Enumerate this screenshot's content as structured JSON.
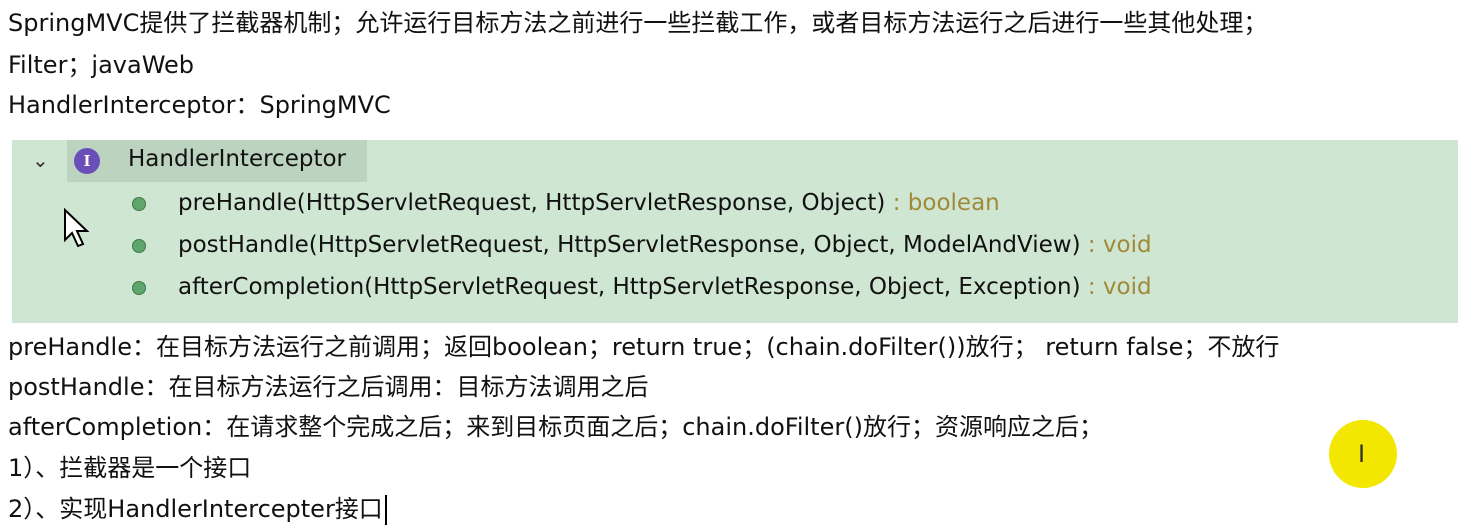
{
  "lines_top": [
    "SpringMVC提供了拦截器机制；允许运行目标方法之前进行一些拦截工作，或者目标方法运行之后进行一些其他处理；",
    "Filter；javaWeb",
    "HandlerInterceptor：SpringMVC"
  ],
  "outline": {
    "title": "HandlerInterceptor",
    "icon_letter": "I",
    "methods": [
      {
        "sig": "preHandle(HttpServletRequest, HttpServletResponse, Object)",
        "ret": " : boolean"
      },
      {
        "sig": "postHandle(HttpServletRequest, HttpServletResponse, Object, ModelAndView)",
        "ret": " : void"
      },
      {
        "sig": "afterCompletion(HttpServletRequest, HttpServletResponse, Object, Exception)",
        "ret": " : void"
      }
    ]
  },
  "lines_bottom": [
    "preHandle：在目标方法运行之前调用；返回boolean；return true；(chain.doFilter())放行； return false；不放行",
    "postHandle：在目标方法运行之后调用：目标方法调用之后",
    "afterCompletion：在请求整个完成之后；来到目标页面之后；chain.doFilter()放行；资源响应之后；",
    "1）、拦截器是一个接口",
    "2）、实现HandlerIntercepter接口"
  ]
}
